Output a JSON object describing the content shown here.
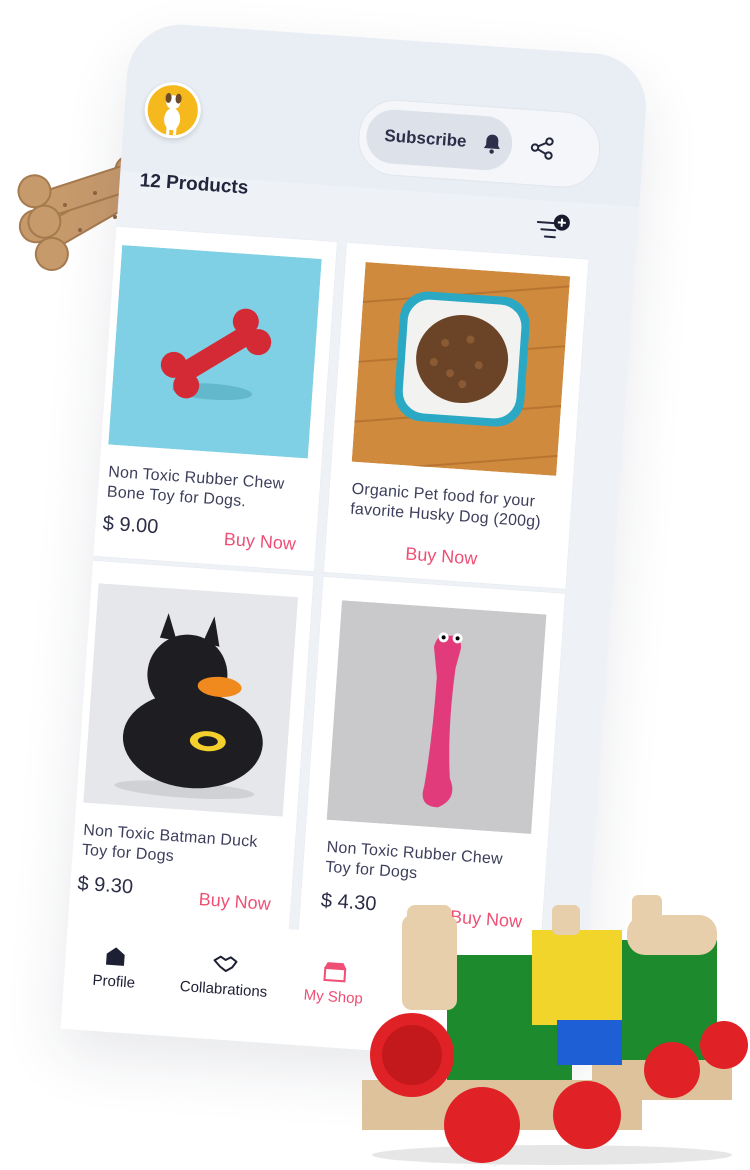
{
  "header": {
    "subscribe_label": "Subscribe",
    "share_icon": "share-icon",
    "bell_icon": "bell-icon"
  },
  "products_count": "12 Products",
  "products": [
    {
      "title_line1": "Non Toxic Rubber Chew",
      "title_line2": "Bone Toy for Dogs.",
      "price": "$ 9.00",
      "action": "Buy Now"
    },
    {
      "title_line1": "Organic Pet food for your",
      "title_line2": "favorite Husky Dog (200g)",
      "price": "",
      "action": "Buy Now"
    },
    {
      "title_line1": "Non Toxic Batman Duck",
      "title_line2": "Toy for Dogs",
      "price": "$ 9.30",
      "action": "Buy Now"
    },
    {
      "title_line1": "Non Toxic Rubber Chew",
      "title_line2": "Toy for Dogs",
      "price": "$ 4.30",
      "action": "Buy Now"
    }
  ],
  "nav": [
    {
      "label": "Profile",
      "icon": "home-icon"
    },
    {
      "label": "Collabrations",
      "icon": "handshake-icon"
    },
    {
      "label": "My Shop",
      "icon": "shop-icon"
    }
  ],
  "colors": {
    "accent": "#ef4f74",
    "text_dark": "#23253c",
    "phone_bg": "#eef2f7"
  }
}
